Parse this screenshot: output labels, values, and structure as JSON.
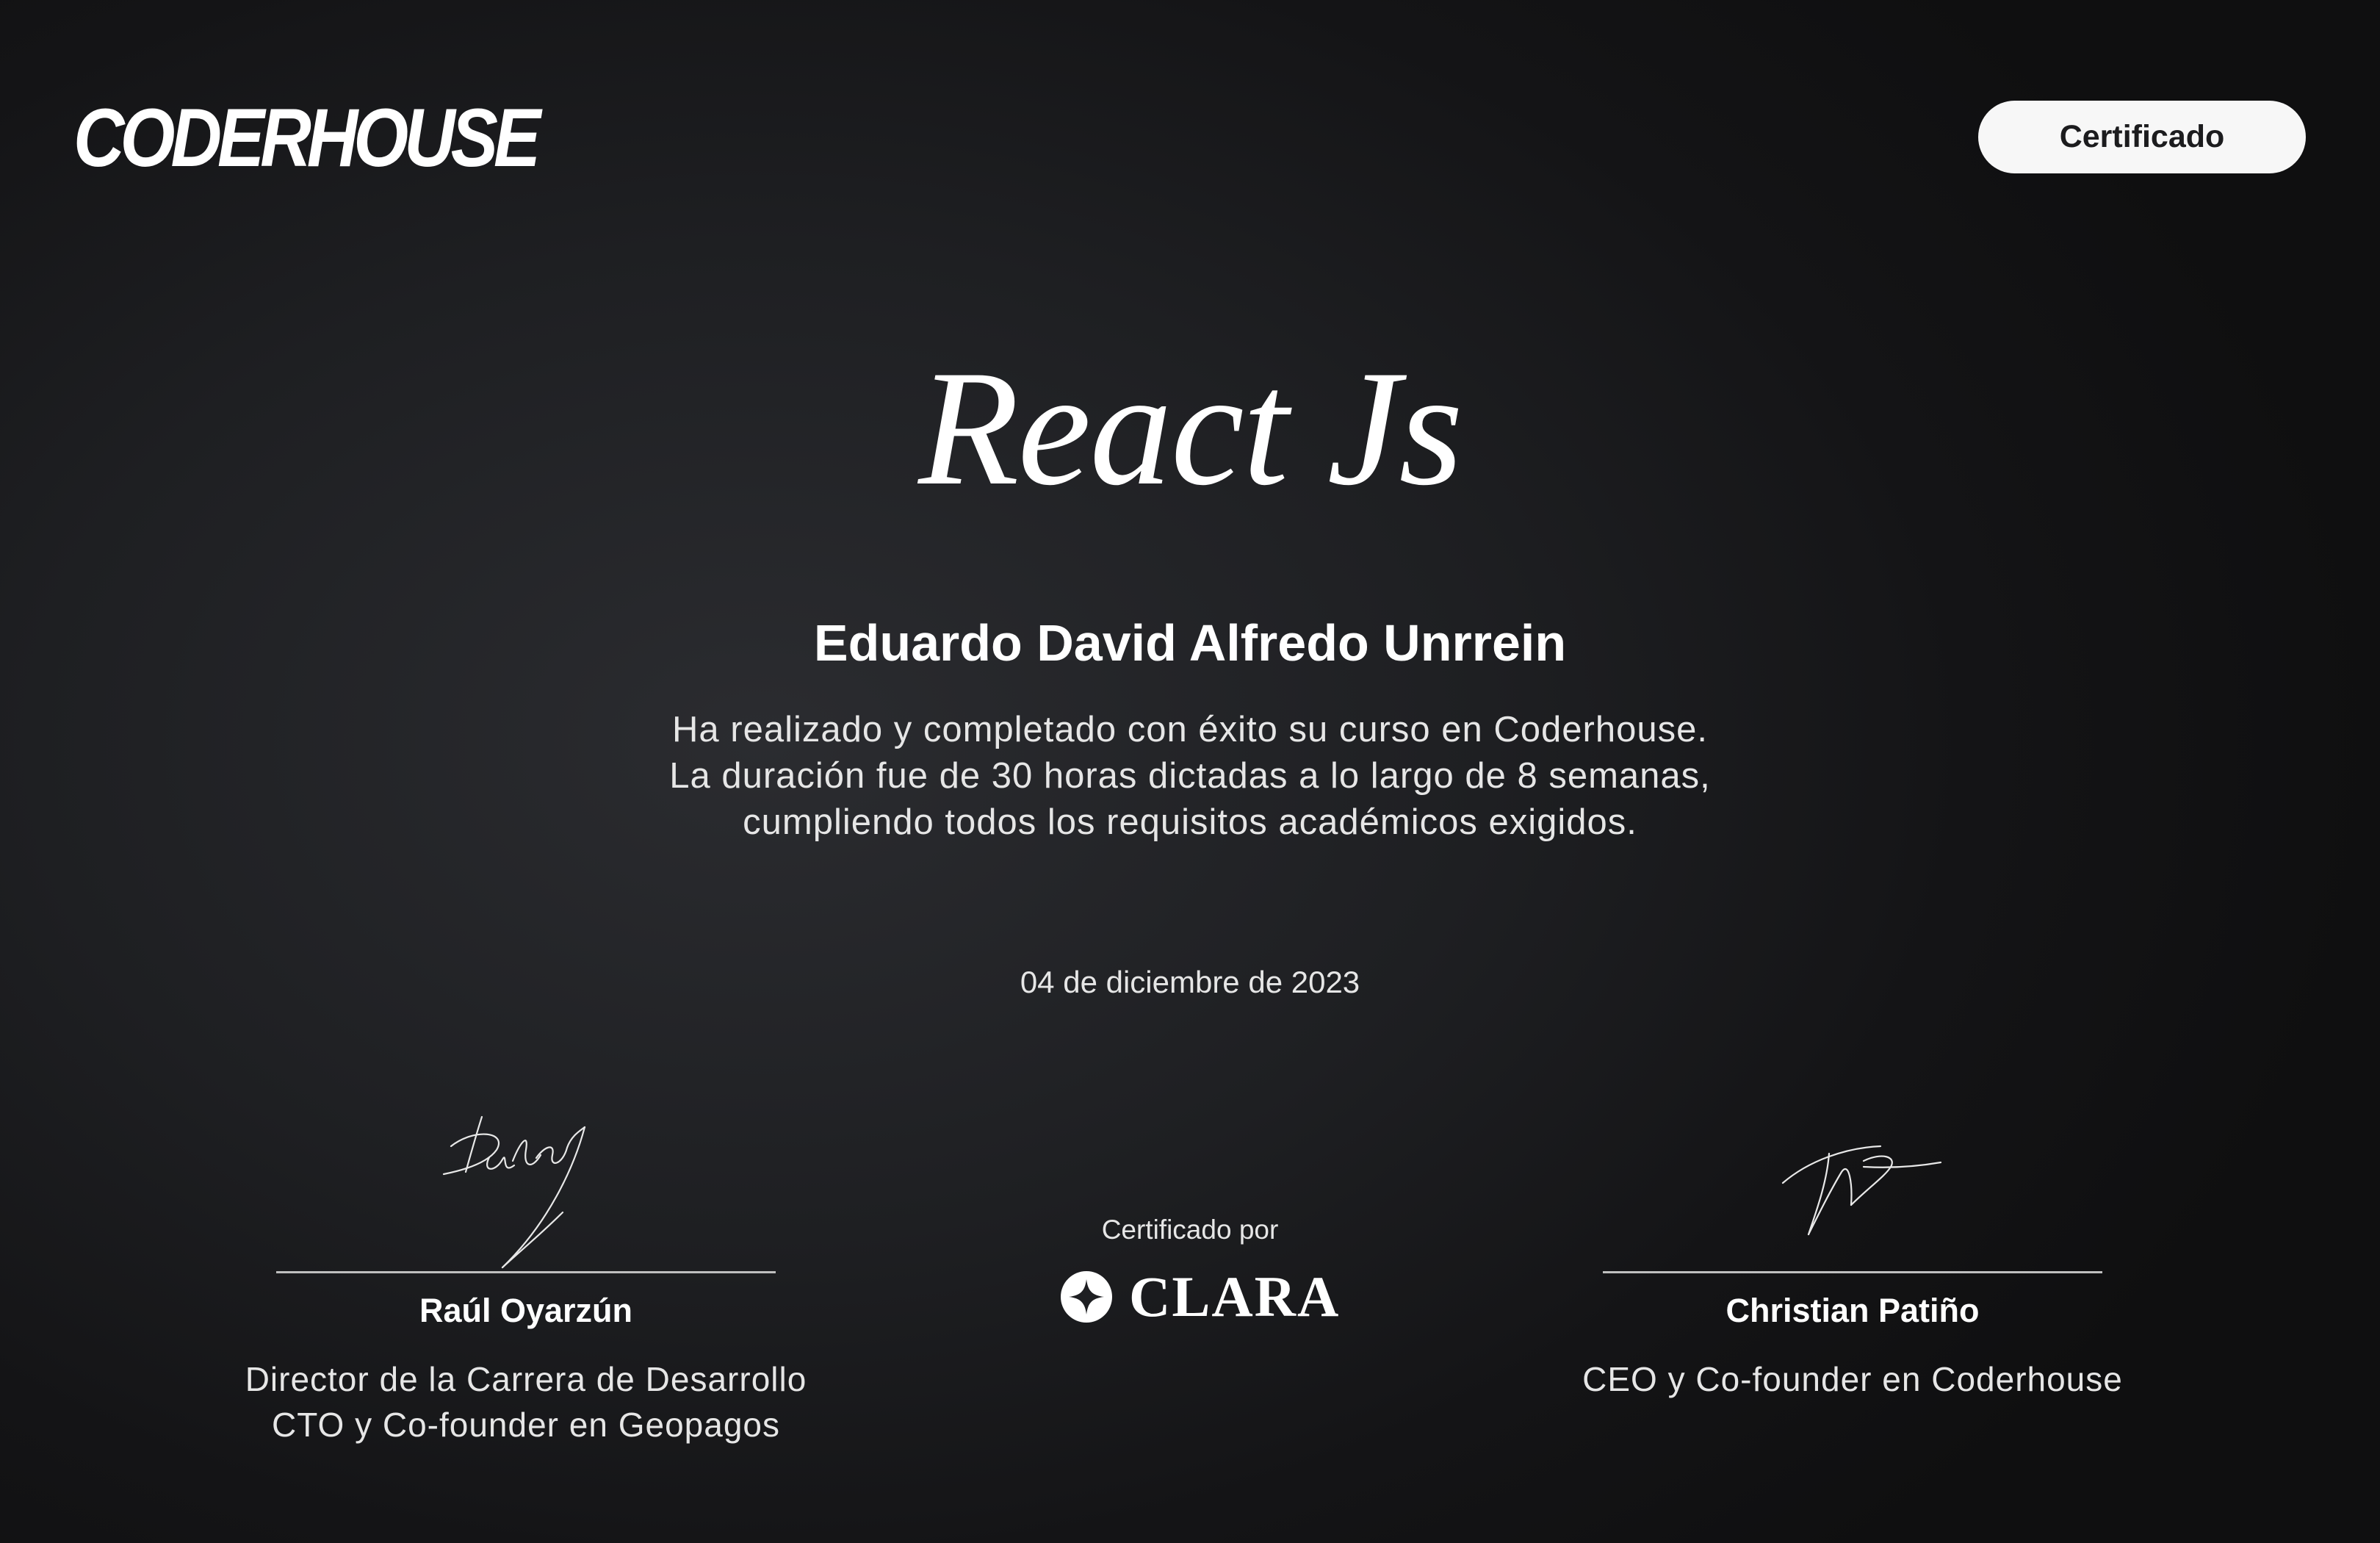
{
  "header": {
    "brand": "CODERHOUSE",
    "badge_label": "Certificado"
  },
  "certificate": {
    "course_title": "React Js",
    "student_name": "Eduardo David Alfredo Unrrein",
    "description_lines": [
      "Ha realizado y completado con éxito su curso en Coderhouse.",
      "La duración fue de 30 horas dictadas a lo largo de 8 semanas,",
      "cumpliendo todos los requisitos académicos exigidos."
    ],
    "date": "04 de diciembre de 2023"
  },
  "signers": [
    {
      "name": "Raúl Oyarzún",
      "role_lines": [
        "Director de la Carrera de Desarrollo",
        "CTO y Co-founder en Geopagos"
      ]
    },
    {
      "name": "Christian Patiño",
      "role_lines": [
        "CEO y Co-founder en Coderhouse"
      ]
    }
  ],
  "certifier": {
    "label": "Certificado por",
    "name": "CLARA",
    "icon": "clara-star-icon"
  },
  "colors": {
    "background": "#1e1f22",
    "text": "#ffffff",
    "badge_background": "#f7f7f7",
    "badge_text": "#1c1c1e"
  }
}
